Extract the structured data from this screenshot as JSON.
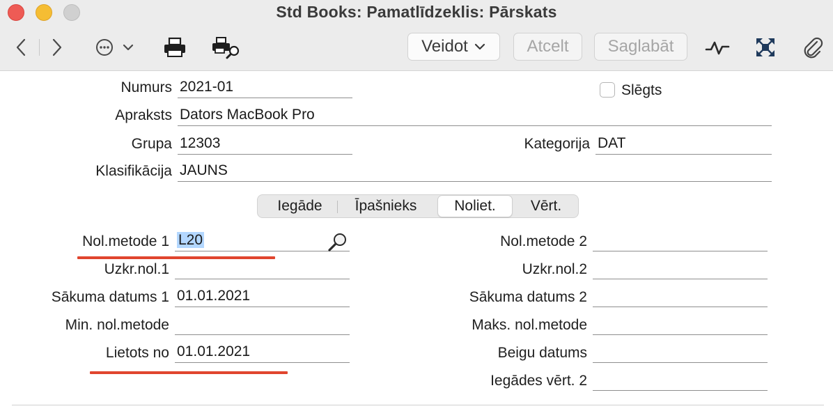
{
  "window": {
    "title": "Std Books: Pamatlīdzeklis: Pārskats"
  },
  "toolbar": {
    "back_icon": "chevron-left-icon",
    "forward_icon": "chevron-right-icon",
    "more_icon": "ellipsis-circle-icon",
    "print_icon": "printer-icon",
    "print_preview_icon": "print-preview-icon",
    "veidot_label": "Veidot",
    "atcelt_label": "Atcelt",
    "saglabat_label": "Saglabāt",
    "activity_icon": "activity-graph-icon",
    "fullscreen_icon": "expand-icon",
    "attachment_icon": "paperclip-icon"
  },
  "header": {
    "numurs_label": "Numurs",
    "numurs_value": "2021-01",
    "slegts_label": "Slēgts",
    "slegts_checked": false,
    "apraksts_label": "Apraksts",
    "apraksts_value": "Dators MacBook Pro",
    "grupa_label": "Grupa",
    "grupa_value": "12303",
    "kategorija_label": "Kategorija",
    "kategorija_value": "DAT",
    "klasifikacija_label": "Klasifikācija",
    "klasifikacija_value": "JAUNS"
  },
  "tabs": {
    "items": [
      "Iegāde",
      "Īpašnieks",
      "Noliet.",
      "Vērt."
    ],
    "active": "Noliet."
  },
  "noliet": {
    "left": {
      "metode1_label": "Nol.metode 1",
      "metode1_value": "L20",
      "uzkr1_label": "Uzkr.nol.1",
      "uzkr1_value": "",
      "sakuma1_label": "Sākuma datums 1",
      "sakuma1_value": "01.01.2021",
      "min_label": "Min. nol.metode",
      "min_value": "",
      "lietots_label": "Lietots no",
      "lietots_value": "01.01.2021"
    },
    "right": {
      "metode2_label": "Nol.metode 2",
      "metode2_value": "",
      "uzkr2_label": "Uzkr.nol.2",
      "uzkr2_value": "",
      "sakuma2_label": "Sākuma datums 2",
      "sakuma2_value": "",
      "maks_label": "Maks. nol.metode",
      "maks_value": "",
      "beigu_label": "Beigu datums",
      "beigu_value": "",
      "iegades_label": "Iegādes vērt. 2",
      "iegades_value": ""
    }
  },
  "colors": {
    "highlight_underline": "#e0452e",
    "selection": "#b3d7ff"
  }
}
